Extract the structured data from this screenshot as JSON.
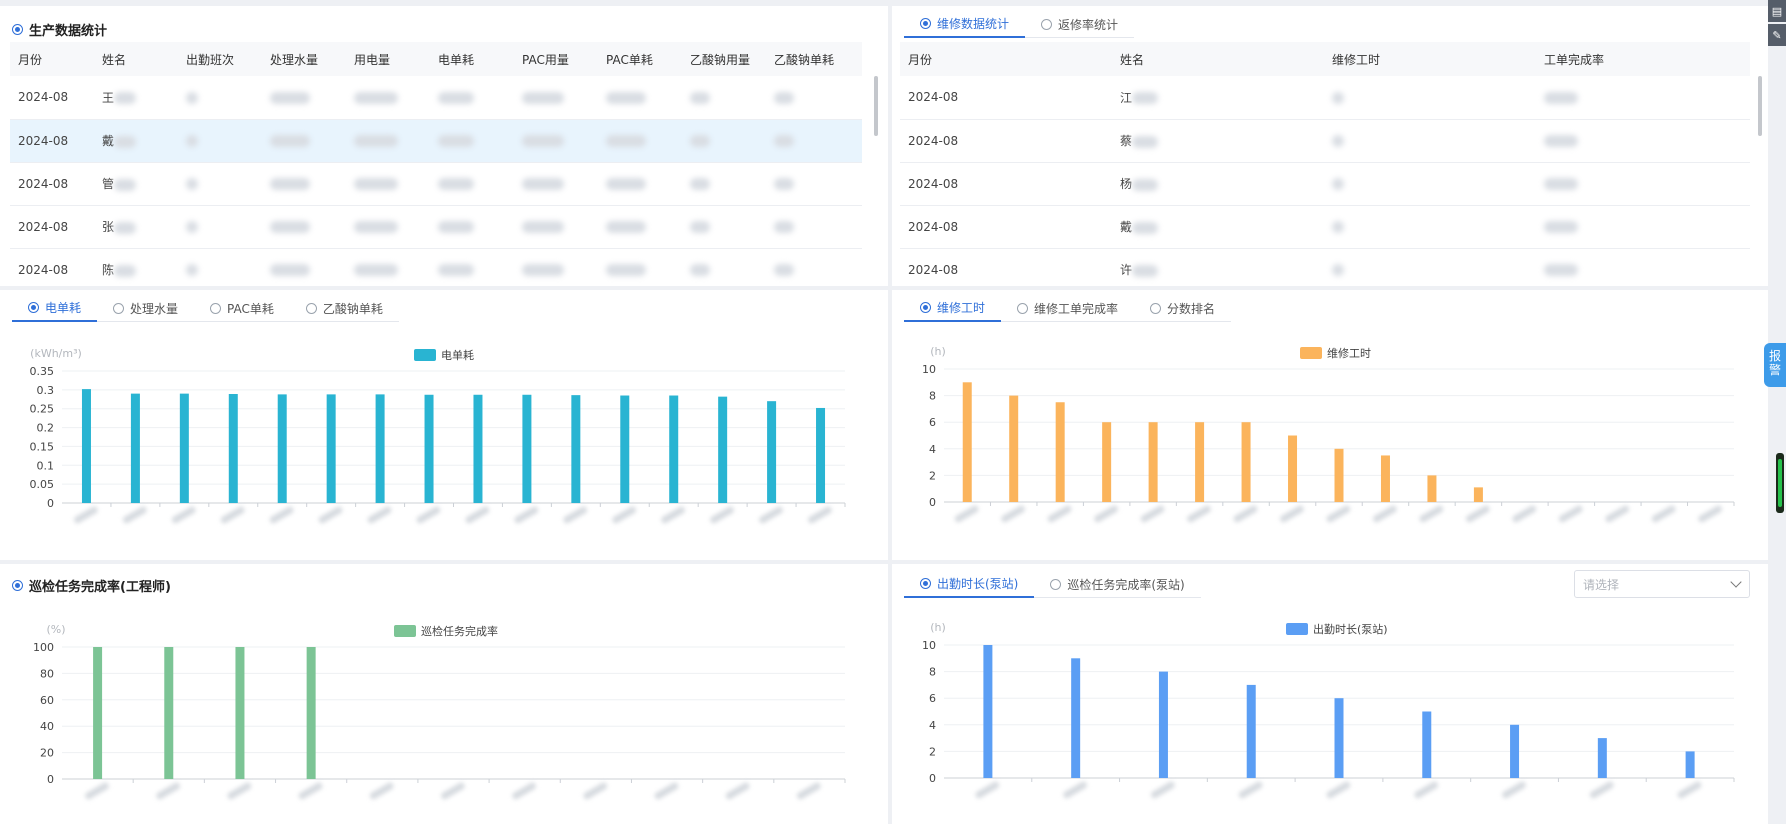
{
  "production": {
    "title": "生产数据统计",
    "columns": [
      "月份",
      "姓名",
      "出勤班次",
      "处理水量",
      "用电量",
      "电单耗",
      "PAC用量",
      "PAC单耗",
      "乙酸钠用量",
      "乙酸钠单耗"
    ],
    "rows": [
      {
        "month": "2024-08",
        "name": "王"
      },
      {
        "month": "2024-08",
        "name": "戴"
      },
      {
        "month": "2024-08",
        "name": "管"
      },
      {
        "month": "2024-08",
        "name": "张"
      },
      {
        "month": "2024-08",
        "name": "陈"
      }
    ]
  },
  "maintenance": {
    "tabs": [
      "维修数据统计",
      "返修率统计"
    ],
    "columns": [
      "月份",
      "姓名",
      "维修工时",
      "工单完成率"
    ],
    "rows": [
      {
        "month": "2024-08",
        "name": "江"
      },
      {
        "month": "2024-08",
        "name": "蔡"
      },
      {
        "month": "2024-08",
        "name": "杨"
      },
      {
        "month": "2024-08",
        "name": "戴"
      },
      {
        "month": "2024-08",
        "name": "许"
      }
    ]
  },
  "chart1": {
    "tabs": [
      "电单耗",
      "处理水量",
      "PAC单耗",
      "乙酸钠单耗"
    ]
  },
  "chart2": {
    "tabs": [
      "维修工时",
      "维修工单完成率",
      "分数排名"
    ]
  },
  "chart3": {
    "title": "巡检任务完成率(工程师)"
  },
  "chart4": {
    "tabs": [
      "出勤时长(泵站)",
      "巡检任务完成率(泵站)"
    ],
    "select_placeholder": "请选择"
  },
  "side": {
    "alarm_label": "报警"
  },
  "colors": {
    "accent": "#2f6fd8",
    "chart1": "#29b4d2",
    "chart2": "#fbb45c",
    "chart3": "#7cc495",
    "chart4": "#5b9ef4"
  },
  "chart_data": [
    {
      "type": "bar",
      "ylabel": "(kWh/m³)",
      "ylim": [
        0,
        0.35
      ],
      "yticks": [
        "0",
        "0.05",
        "0.1",
        "0.15",
        "0.2",
        "0.25",
        "0.3",
        "0.35"
      ],
      "series": [
        {
          "name": "电单耗",
          "values": [
            0.302,
            0.29,
            0.29,
            0.289,
            0.288,
            0.288,
            0.288,
            0.287,
            0.287,
            0.287,
            0.286,
            0.285,
            0.285,
            0.282,
            0.27,
            0.252
          ]
        }
      ],
      "legend": "top-center"
    },
    {
      "type": "bar",
      "ylabel": "(h)",
      "ylim": [
        0,
        10
      ],
      "yticks": [
        "0",
        "2",
        "4",
        "6",
        "8",
        "10"
      ],
      "series": [
        {
          "name": "维修工时",
          "values": [
            9,
            8,
            7.5,
            6,
            6,
            6,
            6,
            5,
            4,
            3.5,
            2,
            1.1,
            0,
            0,
            0,
            0,
            0
          ]
        }
      ],
      "legend": "top-center"
    },
    {
      "type": "bar",
      "ylabel": "(%)",
      "ylim": [
        0,
        100
      ],
      "yticks": [
        "0",
        "20",
        "40",
        "60",
        "80",
        "100"
      ],
      "series": [
        {
          "name": "巡检任务完成率",
          "values": [
            100,
            100,
            100,
            100,
            0,
            0,
            0,
            0,
            0,
            0,
            0
          ]
        }
      ],
      "legend": "top-center"
    },
    {
      "type": "bar",
      "ylabel": "(h)",
      "ylim": [
        0,
        10
      ],
      "yticks": [
        "0",
        "2",
        "4",
        "6",
        "8",
        "10"
      ],
      "series": [
        {
          "name": "出勤时长(泵站)",
          "values": [
            10,
            9,
            8,
            7,
            6,
            5,
            4,
            3,
            2
          ]
        }
      ],
      "legend": "top-center"
    }
  ]
}
